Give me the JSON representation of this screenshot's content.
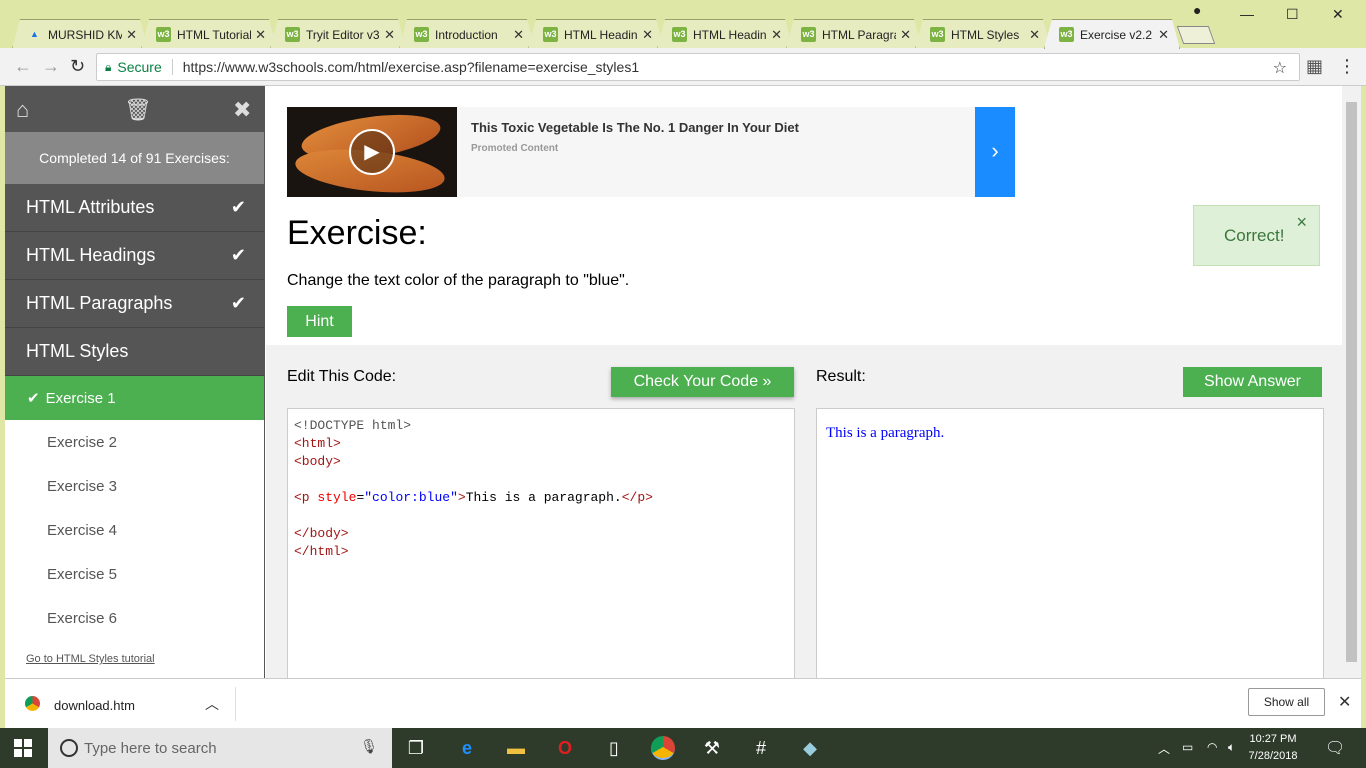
{
  "browser": {
    "tabs": [
      {
        "label": "MURSHID KM",
        "icon": "drive"
      },
      {
        "label": "HTML Tutorial",
        "icon": "w3"
      },
      {
        "label": "Tryit Editor v3",
        "icon": "w3"
      },
      {
        "label": "Introduction",
        "icon": "w3"
      },
      {
        "label": "HTML Headings",
        "icon": "w3"
      },
      {
        "label": "HTML Headings",
        "icon": "w3"
      },
      {
        "label": "HTML Paragraphs",
        "icon": "w3"
      },
      {
        "label": "HTML Styles",
        "icon": "w3"
      },
      {
        "label": "Exercise v2.2",
        "icon": "w3",
        "active": true
      }
    ],
    "secure_label": "Secure",
    "url": "https://www.w3schools.com/html/exercise.asp?filename=exercise_styles1"
  },
  "sidebar": {
    "progress": "Completed 14 of 91 Exercises:",
    "sections": [
      {
        "label": "HTML Attributes",
        "done": true
      },
      {
        "label": "HTML Headings",
        "done": true
      },
      {
        "label": "HTML Paragraphs",
        "done": true
      },
      {
        "label": "HTML Styles",
        "done": false
      }
    ],
    "exercises": [
      "Exercise 1",
      "Exercise 2",
      "Exercise 3",
      "Exercise 4",
      "Exercise 5",
      "Exercise 6"
    ],
    "tutorial_link": "Go to HTML Styles tutorial"
  },
  "ad": {
    "title": "This Toxic Vegetable Is The No. 1 Danger In Your Diet",
    "sub": "Promoted Content"
  },
  "exercise": {
    "heading": "Exercise:",
    "task": "Change the text color of the paragraph to \"blue\".",
    "hint_label": "Hint",
    "correct_label": "Correct!",
    "edit_label": "Edit This Code:",
    "check_label": "Check Your Code »",
    "result_label": "Result:",
    "answer_label": "Show Answer",
    "code": {
      "doctype": "<!DOCTYPE html>",
      "html_open": "<html>",
      "body_open": "<body>",
      "p_tag_open": "<p",
      "p_attr": "style",
      "p_eq": "=",
      "p_val": "\"color:blue\"",
      "p_gt": ">",
      "p_text": "This is a paragraph.",
      "p_close": "</p>",
      "body_close": "</body>",
      "html_close": "</html>"
    },
    "result_text": "This is a paragraph."
  },
  "downloads": {
    "file": "download.htm",
    "show_all": "Show all"
  },
  "taskbar": {
    "search_placeholder": "Type here to search",
    "time": "10:27 PM",
    "date": "7/28/2018"
  },
  "colors": {
    "w3_green": "#4caf50",
    "sidebar_dark": "#555555",
    "result_blue": "#0000ff"
  }
}
